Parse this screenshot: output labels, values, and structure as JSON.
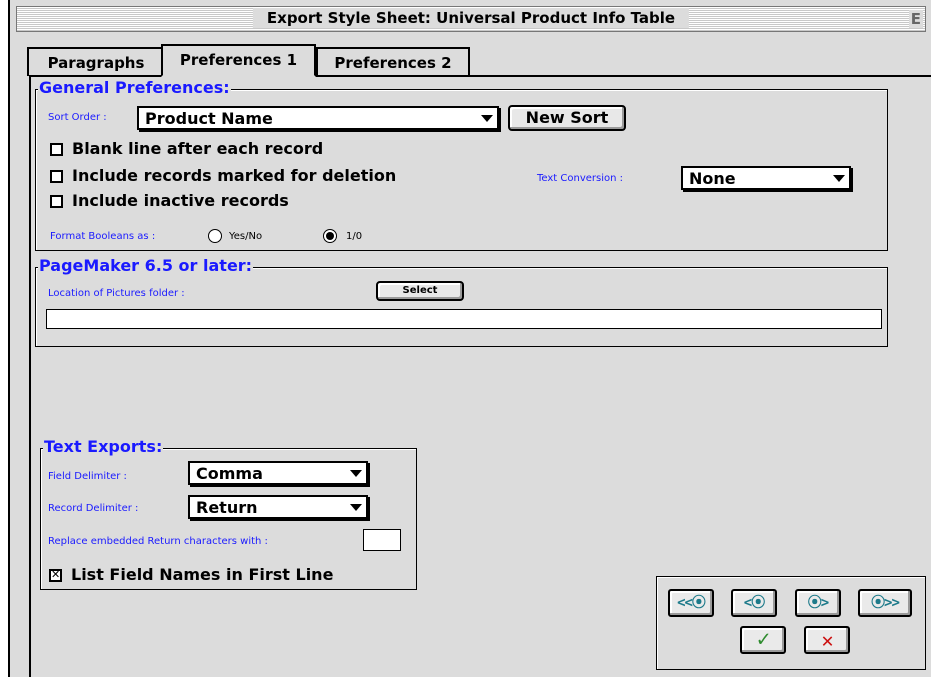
{
  "window": {
    "title": "Export Style Sheet: Universal Product Info Table",
    "zoom_glyph": "E"
  },
  "tabs": [
    {
      "label": "Paragraphs"
    },
    {
      "label": "Preferences 1",
      "active": true
    },
    {
      "label": "Preferences 2"
    }
  ],
  "general": {
    "legend": "General Preferences:",
    "sort_order_label": "Sort Order :",
    "sort_order_value": "Product Name",
    "new_sort_label": "New Sort",
    "blank_line_label": "Blank line after each record",
    "blank_line_checked": false,
    "include_deleted_label": "Include records marked for deletion",
    "include_deleted_checked": false,
    "include_inactive_label": "Include inactive records",
    "include_inactive_checked": false,
    "text_conversion_label": "Text Conversion :",
    "text_conversion_value": "None",
    "format_booleans_label": "Format Booleans as :",
    "boolean_option_yesno": "Yes/No",
    "boolean_option_10": "1/0",
    "boolean_selected": "1/0"
  },
  "pagemaker": {
    "legend": "PageMaker 6.5 or later:",
    "pictures_folder_label": "Location of Pictures folder :",
    "select_label": "Select",
    "pictures_folder_value": ""
  },
  "text_exports": {
    "legend": "Text Exports:",
    "field_delimiter_label": "Field Delimiter :",
    "field_delimiter_value": "Comma",
    "record_delimiter_label": "Record Delimiter :",
    "record_delimiter_value": "Return",
    "replace_label": "Replace embedded Return characters with :",
    "replace_value": "",
    "list_field_names_label": "List Field Names in First Line",
    "list_field_names_checked": true
  },
  "navigation": {
    "first": "<<⦿",
    "prev": "<⦿",
    "next": "⦿>",
    "last": "⦿>>",
    "ok": "✓",
    "cancel": "✕",
    "colors": {
      "nav_glyph": "#1d7a8a",
      "ok": "#2e8b2e",
      "cancel": "#cc1111"
    }
  },
  "colors": {
    "legend_blue": "#1a1aff",
    "window_bg": "#dcdcdc"
  }
}
